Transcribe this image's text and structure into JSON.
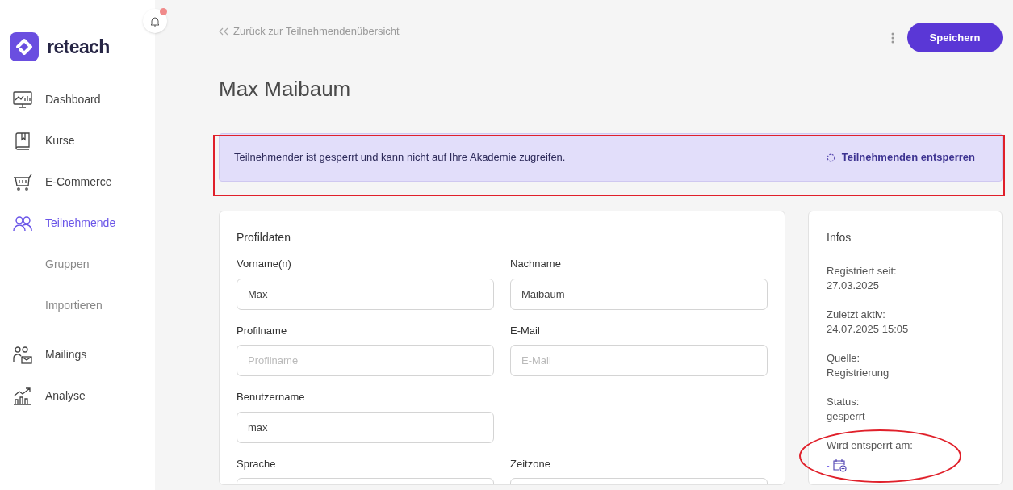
{
  "brand": {
    "name": "reteach"
  },
  "notifications": {
    "unread": true
  },
  "sidebar": {
    "items": [
      {
        "label": "Dashboard",
        "kind": "dashboard",
        "selected": false
      },
      {
        "label": "Kurse",
        "kind": "book",
        "selected": false
      },
      {
        "label": "E-Commerce",
        "kind": "cart",
        "selected": false
      },
      {
        "label": "Teilnehmende",
        "kind": "users",
        "selected": true,
        "children": [
          {
            "label": "Gruppen",
            "selected": false
          },
          {
            "label": "Importieren",
            "selected": false
          }
        ]
      },
      {
        "label": "Mailings",
        "kind": "mail",
        "selected": false
      },
      {
        "label": "Analyse",
        "kind": "chart",
        "selected": false
      }
    ]
  },
  "back_link": "Zurück zur Teilnehmendenübersicht",
  "save_button": "Speichern",
  "page_title": "Max Maibaum",
  "alert": {
    "message": "Teilnehmender ist gesperrt und kann nicht auf Ihre Akademie zugreifen.",
    "action": "Teilnehmenden entsperren"
  },
  "profile": {
    "title": "Profildaten",
    "fields": [
      {
        "label": "Vorname(n)",
        "value": "Max"
      },
      {
        "label": "Nachname",
        "value": "Maibaum"
      },
      {
        "label": "Profilname",
        "placeholder": "Profilname"
      },
      {
        "label": "E-Mail",
        "placeholder": "E-Mail"
      },
      {
        "label": "Benutzername",
        "value": "max"
      },
      {
        "kind": "spacer"
      },
      {
        "label": "Sprache"
      },
      {
        "label": "Zeitzone"
      }
    ]
  },
  "infos": {
    "title": "Infos",
    "items": [
      {
        "label": "Registriert seit:",
        "value": "27.03.2025"
      },
      {
        "label": "Zuletzt aktiv:",
        "value": "24.07.2025 15:05"
      },
      {
        "label": "Quelle:",
        "value": "Registrierung"
      },
      {
        "label": "Status:",
        "value": "gesperrt"
      },
      {
        "label": "Wird entsperrt am:",
        "value": "-",
        "kind": "date-picker"
      }
    ]
  }
}
